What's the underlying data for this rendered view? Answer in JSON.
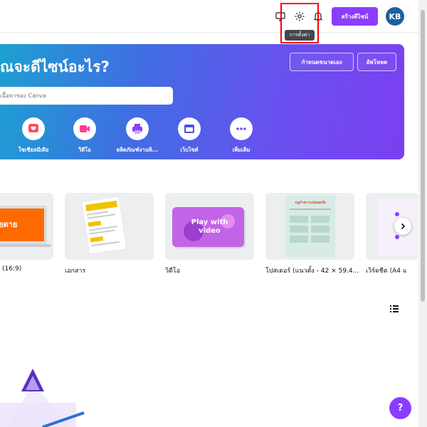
{
  "topbar": {
    "icons": [
      "device-icon",
      "gear-icon",
      "bell-icon"
    ],
    "tooltip": "การตั้งค่า",
    "create_label": "สร้างดีไซน์",
    "avatar_initials": "KB"
  },
  "hero": {
    "title": "ณจะดีไซน์อะไร?",
    "custom_size_label": "กำหนดขนาดเอง",
    "upload_label": "อัพโหลด",
    "search_placeholder": "เนื้อหาของ Canva",
    "categories": [
      {
        "label": "โซเชียลมีเดีย",
        "icon": "heart-icon"
      },
      {
        "label": "วิดีโอ",
        "icon": "video-camera-icon"
      },
      {
        "label": "ผลิตภัณฑ์งานพิ...",
        "icon": "printer-icon"
      },
      {
        "label": "เว็บไซต์",
        "icon": "browser-window-icon"
      },
      {
        "label": "เพิ่มเติม",
        "icon": "more-dots-icon"
      }
    ]
  },
  "templates": {
    "items": [
      {
        "label": "(16:9)",
        "thumb_text": "ด์\nายดาย"
      },
      {
        "label": "เอกสาร",
        "thumb_text": ""
      },
      {
        "label": "วิดีโอ",
        "thumb_text": "Play with\nvideo"
      },
      {
        "label": "โปสเตอร์ (แนวตั้ง - 42 × 59.4...",
        "thumb_text": "กฎกำความปลอดภัย"
      },
      {
        "label": "เวิร์ดชีต (A4 แ",
        "thumb_text": ""
      }
    ]
  },
  "help_label": "?",
  "colors": {
    "accent": "#8b3dff",
    "avatar": "#1e5fa0",
    "highlight": "#ff0000"
  }
}
